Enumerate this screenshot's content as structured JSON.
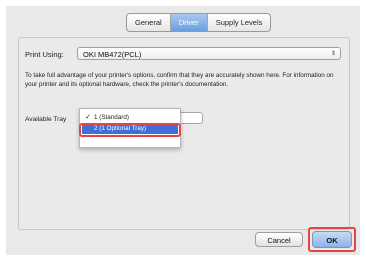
{
  "tabs": [
    {
      "label": "General"
    },
    {
      "label": "Driver"
    },
    {
      "label": "Supply Levels"
    }
  ],
  "print_using": {
    "label": "Print Using:",
    "value": "OKI MB472(PCL)"
  },
  "info_text": "To take full advantage of your printer's options, confirm that they are accurately shown here. For information on your printer and its optional hardware, check the printer's documentation.",
  "available_tray": {
    "label": "Available Tray",
    "options": [
      {
        "label": "1 (Standard)",
        "checked": true
      },
      {
        "label": "2 (1 Optional Tray)",
        "highlighted": true
      }
    ]
  },
  "buttons": {
    "cancel": "Cancel",
    "ok": "OK"
  },
  "colors": {
    "highlight_red": "#e24545",
    "selection_blue": "#3e6fd6",
    "active_tab": "#6b9fdf"
  }
}
